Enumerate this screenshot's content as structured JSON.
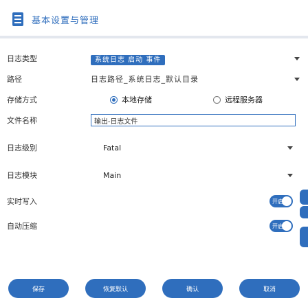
{
  "header": {
    "title": "基本设置与管理"
  },
  "form": {
    "type": {
      "label": "日志类型",
      "value": "系统日志 启动 事件"
    },
    "path": {
      "label": "路径",
      "value": "日志路径_系统日志_默认目录"
    },
    "mode": {
      "label": "存储方式",
      "option_a": "本地存储",
      "option_b": "远程服务器"
    },
    "name": {
      "label": "文件名称",
      "value": "输出-日志文件"
    },
    "level": {
      "label": "日志级别",
      "value": "Fatal"
    },
    "module": {
      "label": "日志模块",
      "value": "Main"
    },
    "switch1": {
      "label": "实时写入",
      "state": "开启"
    },
    "switch2": {
      "label": "自动压缩",
      "state": "开启"
    }
  },
  "buttons": {
    "b1": "保存",
    "b2": "恢复默认",
    "b3": "确认",
    "b4": "取消"
  },
  "colors": {
    "accent": "#2f6ebd"
  }
}
